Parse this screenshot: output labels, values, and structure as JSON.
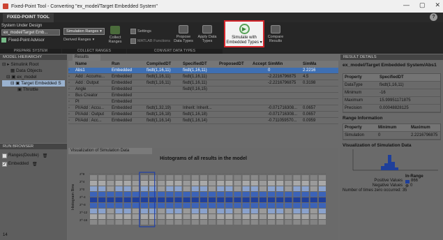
{
  "window": {
    "title": "Fixed-Point Tool - Converting \"ex_model/Target Embedded System\"",
    "controls": [
      "—",
      "▢",
      "✕"
    ]
  },
  "tabs": {
    "active": "FIXED-POINT TOOL",
    "help": "?"
  },
  "toolstrip": {
    "prepare": {
      "label": "System Under Design",
      "value": "ex_model/Target Emb...",
      "advisor": "Fixed-Point Advisor",
      "section": "PREPARE SYSTEM"
    },
    "collect": {
      "sim_ranges": "Simulation Ranges",
      "derived_ranges": "Derived Ranges",
      "collect": "Collect Ranges",
      "section": "COLLECT RANGES"
    },
    "convert": {
      "settings": "Settings",
      "matlab_functions": "MATLAB Functions",
      "propose": "Propose Data Types",
      "apply": "Apply Data Types",
      "section": "CONVERT DATA TYPES"
    },
    "verify": {
      "simulate": "Simulate with Embedded Types",
      "compare": "Compare Results"
    }
  },
  "hierarchy": {
    "title": "MODEL HIERARCHY",
    "items": [
      "Simulink Root",
      "Data Objects",
      "ex_model",
      "Target Embedded S",
      "Throttle"
    ]
  },
  "run_browser": {
    "title": "RUN BROWSER",
    "runs": [
      {
        "label": "Ranges(Double)",
        "checked": false
      },
      {
        "label": "Embedded",
        "checked": true
      }
    ]
  },
  "results": {
    "tab": "Results",
    "columns": [
      "Name",
      "Run",
      "CompiledDT",
      "SpecifiedDT",
      "ProposedDT",
      "Accept",
      "SimMin",
      "SimMa"
    ],
    "rows": [
      [
        "Abs1",
        "Embedded",
        "fixdt(1,16,11)",
        "fixdt(1,16,11)",
        "",
        "",
        "0",
        "2.2216"
      ],
      [
        "Add : Accumu...",
        "Embedded",
        "fixdt(1,16,11)",
        "fixdt(1,16,11)",
        "",
        "",
        "-2.2216796875",
        "4.5"
      ],
      [
        "Add : Output",
        "Embedded",
        "fixdt(1,16,11)",
        "fixdt(1,16,11)",
        "",
        "",
        "-2.2216796875",
        "0.3198"
      ],
      [
        "Angle",
        "Embedded",
        "",
        "fixdt(0,16,15)",
        "",
        "",
        "",
        ""
      ],
      [
        "Bus Creator",
        "Embedded",
        "",
        "",
        "",
        "",
        "",
        ""
      ],
      [
        "PI",
        "Embedded",
        "",
        "",
        "",
        "",
        "",
        ""
      ],
      [
        "PI/Add : Accu...",
        "Embedded",
        "fixdt(1,32,19)",
        "Inherit: Inherit...",
        "",
        "",
        "-0.071716308...",
        "0.0657"
      ],
      [
        "PI/Add : Output",
        "Embedded",
        "fixdt(1,16,18)",
        "fixdt(1,16,18)",
        "",
        "",
        "-0.071716308...",
        "0.0657"
      ],
      [
        "PI/Add : Acc...",
        "Embedded",
        "fixdt(1,16,14)",
        "fixdt(1,16,14)",
        "",
        "",
        "-0.711059570...",
        "0.0959"
      ]
    ]
  },
  "visualization": {
    "tab": "Visualization of Simulation Data",
    "title": "Histograms of all results in the model",
    "ylabel": "Histogram Bins",
    "yticks": [
      "2^8",
      "2^4",
      "2^0",
      "2^-4",
      "2^-8",
      "2^-12",
      "2^-16"
    ],
    "columns": 28
  },
  "details": {
    "title": "RESULT DETAILS",
    "path": "ex_model/Target Embedded System/Abs1",
    "header": [
      "Property",
      "SpecifiedDT"
    ],
    "rows": [
      [
        "DataType",
        "fixdt(1,16,11)"
      ],
      [
        "Minimum",
        "-16"
      ],
      [
        "Maximum",
        "15.99951171875"
      ],
      [
        "Precision",
        "0.00048828125"
      ]
    ],
    "range_title": "Range Information",
    "range_header": [
      "Property",
      "Minimum",
      "Maximum"
    ],
    "range_row": [
      "Simulation",
      "0",
      "2.2216796875"
    ],
    "vis_title": "Visualization of Simulation Data",
    "in_range": "In-Range",
    "positive_label": "Positive Values",
    "positive_value": "866",
    "negative_label": "Negative Values",
    "negative_value": "0",
    "zero_label": "Number of times zero occurred: 35"
  },
  "status": {
    "left": "14"
  },
  "colors": {
    "highlight": "#d6262c",
    "selection": "#3e6fb3",
    "histogram": "#1f3f9a"
  }
}
